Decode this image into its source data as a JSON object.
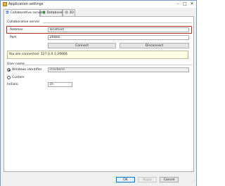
{
  "window": {
    "title": "Application settings",
    "minimize_glyph": "–",
    "maximize_glyph": "□",
    "close_glyph": "✕"
  },
  "tabs": [
    {
      "label": "Collaborative server",
      "icon": "network-server-icon",
      "active": true
    },
    {
      "label": "Databases",
      "icon": "database-icon",
      "active": false
    },
    {
      "label": "3D",
      "icon": "cube-3d-icon",
      "active": false
    }
  ],
  "server": {
    "group_label": "Collaborative server",
    "address_label": "Address:",
    "address_value": "localhost",
    "port_label": "Port:",
    "port_value": "26666",
    "connect_label": "Connect",
    "disconnect_label": "Disconnect",
    "status_text": "You are connected: 127.0.0.1:26666"
  },
  "user": {
    "group_label": "User name",
    "windows_label": "Windows identifier",
    "windows_value": "charbonn",
    "custom_label": "Custom",
    "initials_label": "Initials:",
    "initials_value": "ch"
  },
  "footer": {
    "ok_label": "OK",
    "apply_label": "Apply",
    "cancel_label": "Cancel"
  },
  "colors": {
    "highlight": "#b52b1f",
    "status_background": "#ffffe1",
    "primary_button_border": "#0078d7"
  }
}
